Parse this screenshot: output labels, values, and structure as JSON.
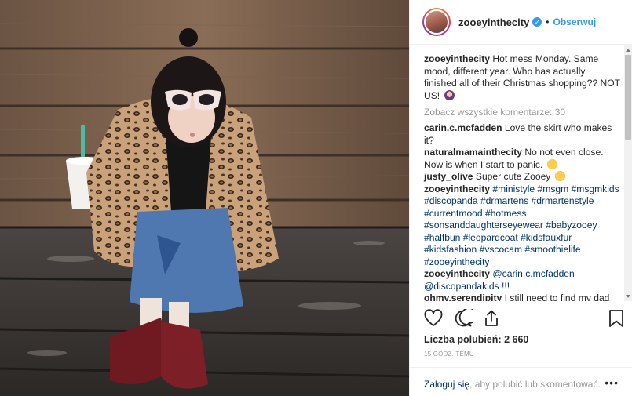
{
  "post": {
    "username": "zooeyinthecity",
    "follow_label": "Obserwuj",
    "dot": "•",
    "verified_mark": "✓",
    "caption_author": "zooeyinthecity",
    "caption_text": "Hot mess Monday. Same mood, different year. Who has actually finished all of their Christmas shopping?? NOT US!",
    "view_all_label": "Zobacz wszystkie komentarze: 30",
    "comments": [
      {
        "author": "carin.c.mcfadden",
        "text": "Love the skirt who makes it?"
      },
      {
        "author": "naturalmamainthecity",
        "text": "No not even close. Now is when I start to panic."
      },
      {
        "author": "justy_olive",
        "text": "Super cute Zooey"
      },
      {
        "author": "zooeyinthecity",
        "text": "#ministyle #msgm #msgmkids #discopanda #drmartens #drmartenstyle #currentmood #hotmess #sonsanddaughterseyewear #babyzooey #halfbun #leopardcoat #kidsfauxfur #kidsfashion #vscocam #smoothielife #zooeyinthecity"
      },
      {
        "author": "zooeyinthecity",
        "text": "@carin.c.mcfadden @discopandakids !!!"
      },
      {
        "author": "ohmy.serendipity",
        "text": "I still need to find my dad"
      }
    ],
    "likes_label": "Liczba polubień: 2 660",
    "time_label": "15 GODZ. TEMU",
    "login_link": "Zaloguj się",
    "login_text": ", aby polubić lub skomentować.",
    "more_label": "•••"
  },
  "icons": {
    "like": "heart-icon",
    "comment": "comment-icon",
    "share": "share-icon",
    "save": "bookmark-icon",
    "verified": "verified-badge-icon"
  },
  "colors": {
    "accent": "#3897f0",
    "link": "#003569",
    "muted": "#999999"
  }
}
